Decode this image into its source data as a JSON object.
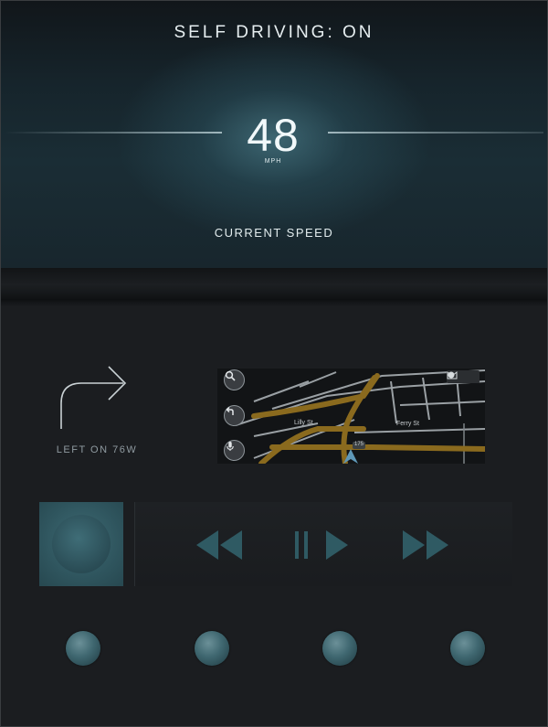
{
  "header": {
    "status": "SELF DRIVING: ON"
  },
  "speed": {
    "value": "48",
    "unit": "MPH",
    "caption": "CURRENT SPEED"
  },
  "navigation": {
    "instruction": "LEFT ON 76W",
    "map": {
      "streets": [
        "Lilly St",
        "Ferry St"
      ],
      "route_badge": "175"
    }
  },
  "media": {
    "controls": [
      "rewind",
      "play-pause",
      "fast-forward"
    ]
  },
  "colors": {
    "accent": "#2f5a63",
    "route": "#8a6a1e",
    "background": "#1b1d20",
    "text": "#e6eef0"
  }
}
